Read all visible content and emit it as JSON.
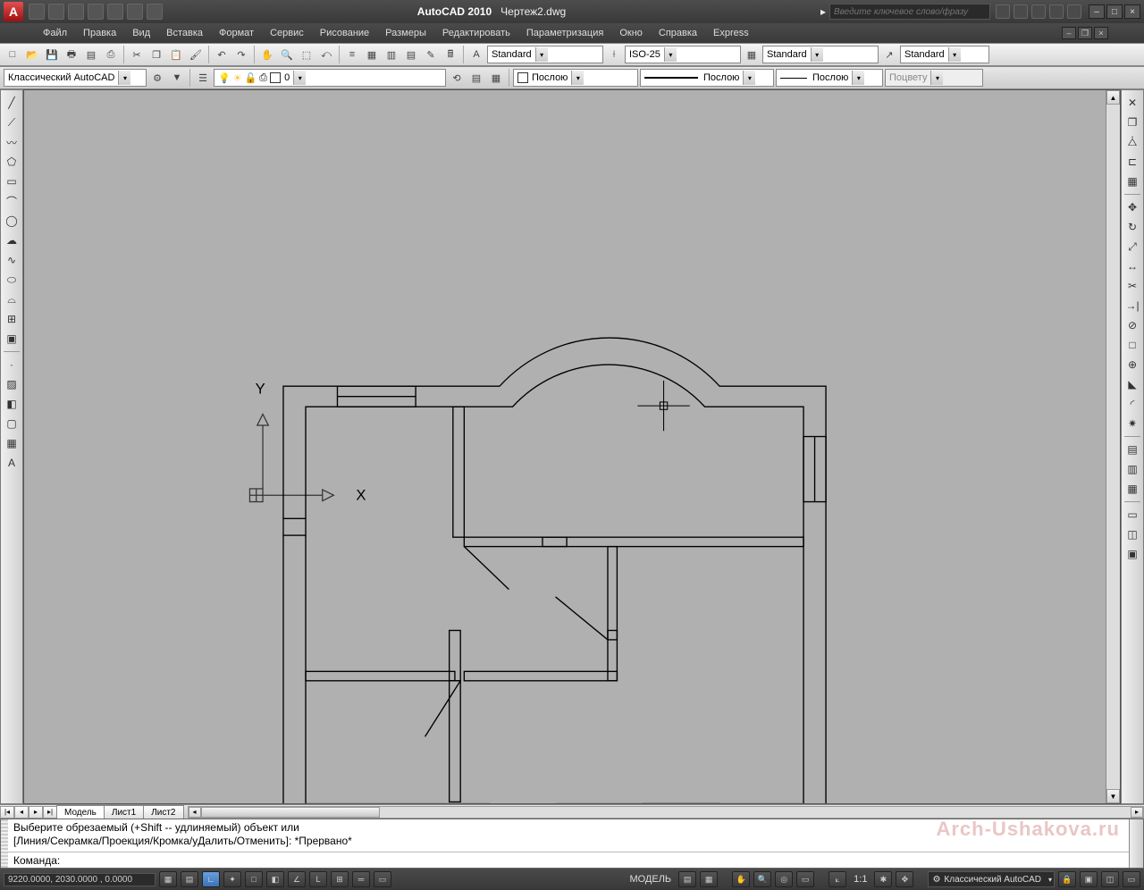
{
  "title": {
    "app": "AutoCAD 2010",
    "doc": "Чертеж2.dwg"
  },
  "search_placeholder": "Введите ключевое слово/фразу",
  "menu": [
    "Файл",
    "Правка",
    "Вид",
    "Вставка",
    "Формат",
    "Сервис",
    "Рисование",
    "Размеры",
    "Редактировать",
    "Параметризация",
    "Окно",
    "Справка",
    "Express"
  ],
  "toolbar1": {
    "textstyle": "Standard",
    "dimstyle": "ISO-25",
    "tablestyle": "Standard",
    "mleaderstyle": "Standard"
  },
  "toolbar2": {
    "workspace": "Классический AutoCAD",
    "layer": "0",
    "color_label": "Послою",
    "linetype_label": "Послою",
    "lineweight_label": "Послою",
    "plotstyle_label": "Поцвету"
  },
  "axes": {
    "x": "X",
    "y": "Y"
  },
  "tabs": {
    "model": "Модель",
    "sheet1": "Лист1",
    "sheet2": "Лист2"
  },
  "cmd": {
    "line1": "Выберите обрезаемый (+Shift -- удлиняемый) объект или",
    "line2": "[Линия/Секрамка/Проекция/Кромка/уДалить/Отменить]: *Прервано*",
    "prompt": "Команда:"
  },
  "watermark": "Arch-Ushakova.ru",
  "status": {
    "coords": "9220.0000, 2030.0000 , 0.0000",
    "model_label": "МОДЕЛЬ",
    "scale": "1:1",
    "workspace": "Классический AutoCAD"
  }
}
